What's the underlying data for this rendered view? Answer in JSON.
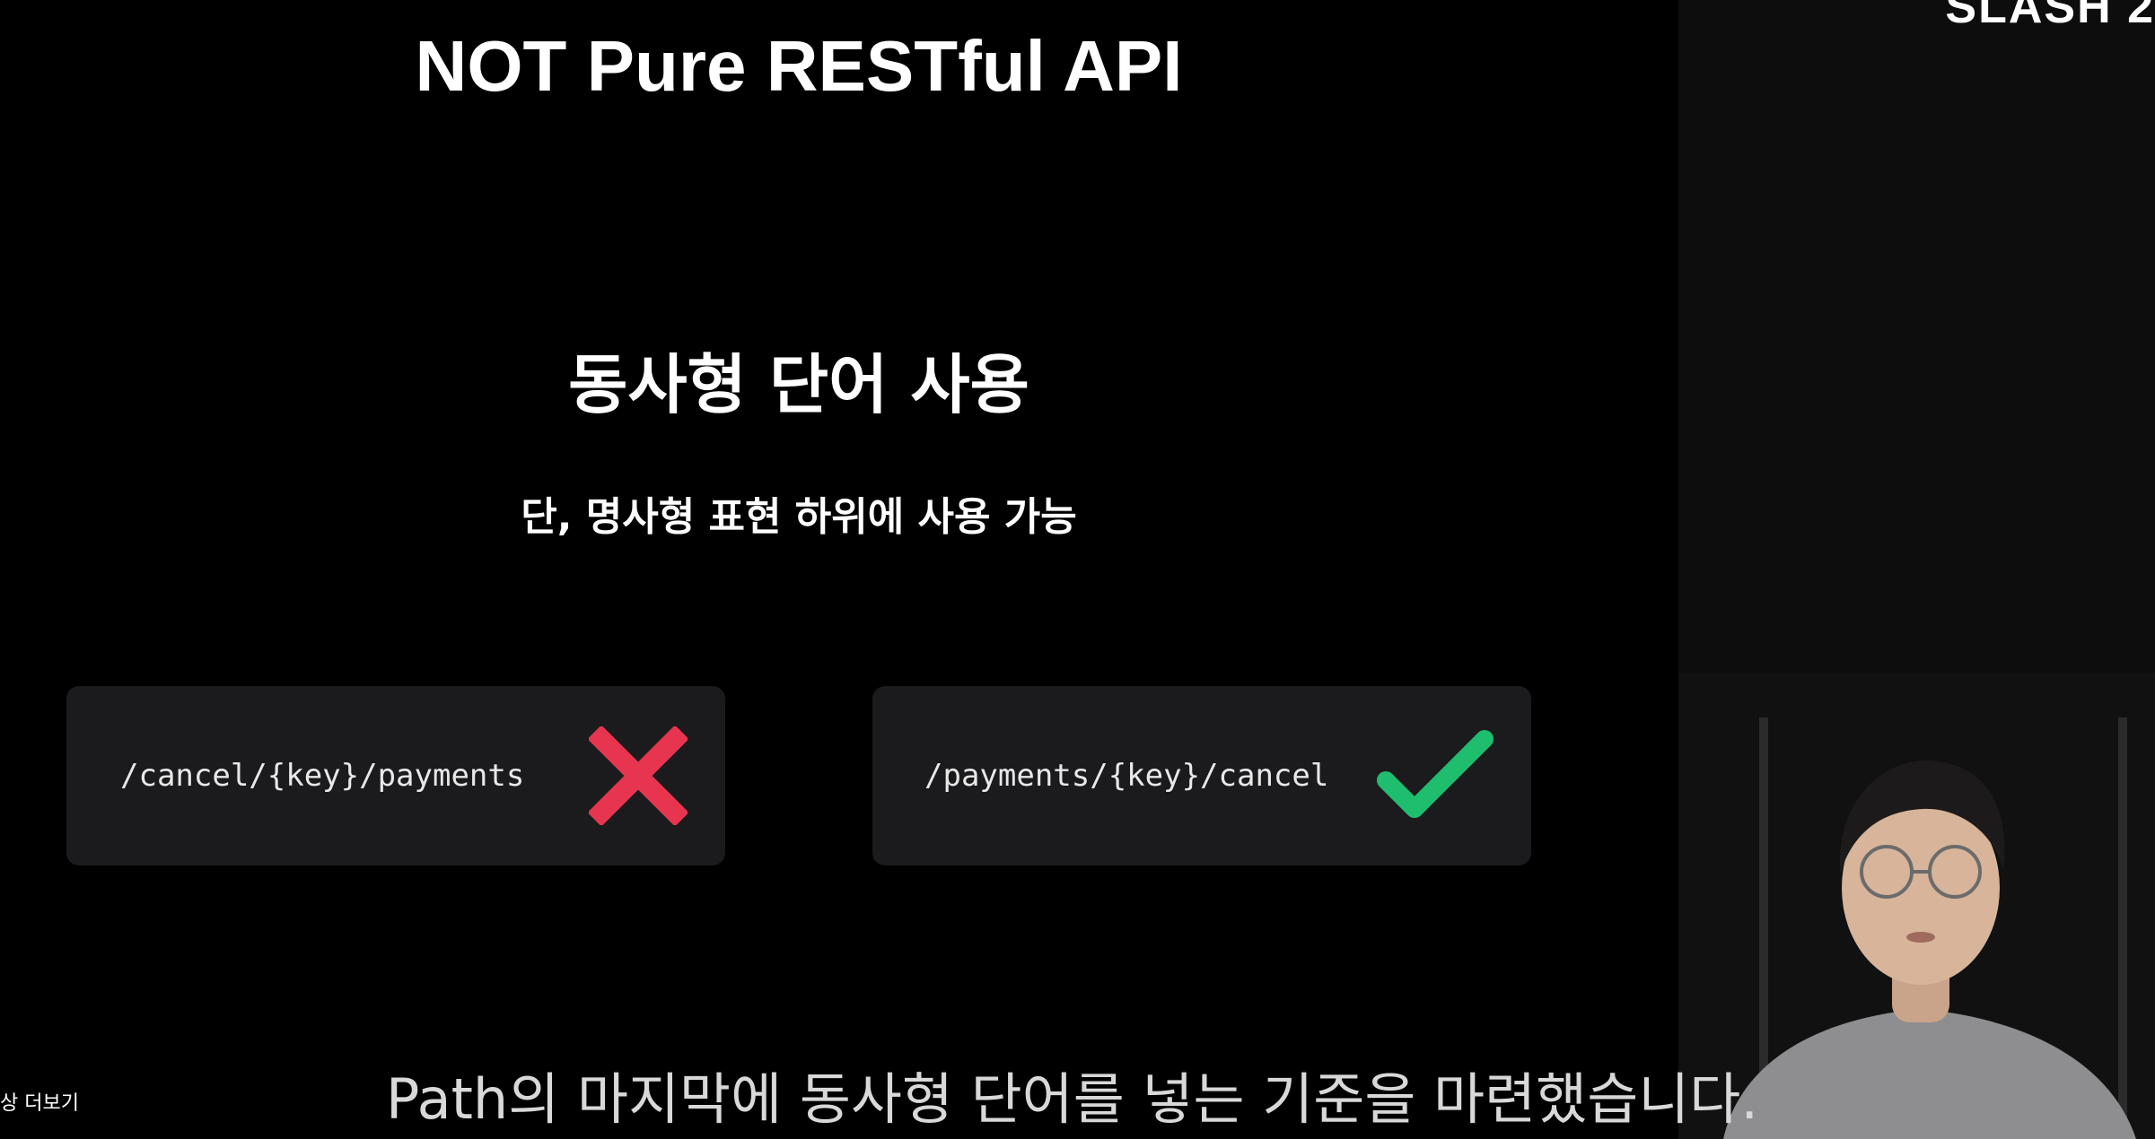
{
  "slide": {
    "title": "NOT Pure RESTful API",
    "heading": "동사형 단어 사용",
    "subheading": "단, 명사형 표현 하위에 사용 가능"
  },
  "examples": [
    {
      "path": "/cancel/{key}/payments",
      "verdict": "incorrect",
      "icon": "cross-icon",
      "color": "#e8354f"
    },
    {
      "path": "/payments/{key}/cancel",
      "verdict": "correct",
      "icon": "checkmark-icon",
      "color": "#1fbe6e"
    }
  ],
  "brand": {
    "text": "SLASH 2"
  },
  "subtitle": {
    "text": "Path의 마지막에 동사형 단어를 넣는 기준을 마련했습니다."
  },
  "more_link": {
    "text": "상 더보기"
  },
  "colors": {
    "background": "#000000",
    "card": "#1b1b1e",
    "panel": "#0d0d0d"
  }
}
